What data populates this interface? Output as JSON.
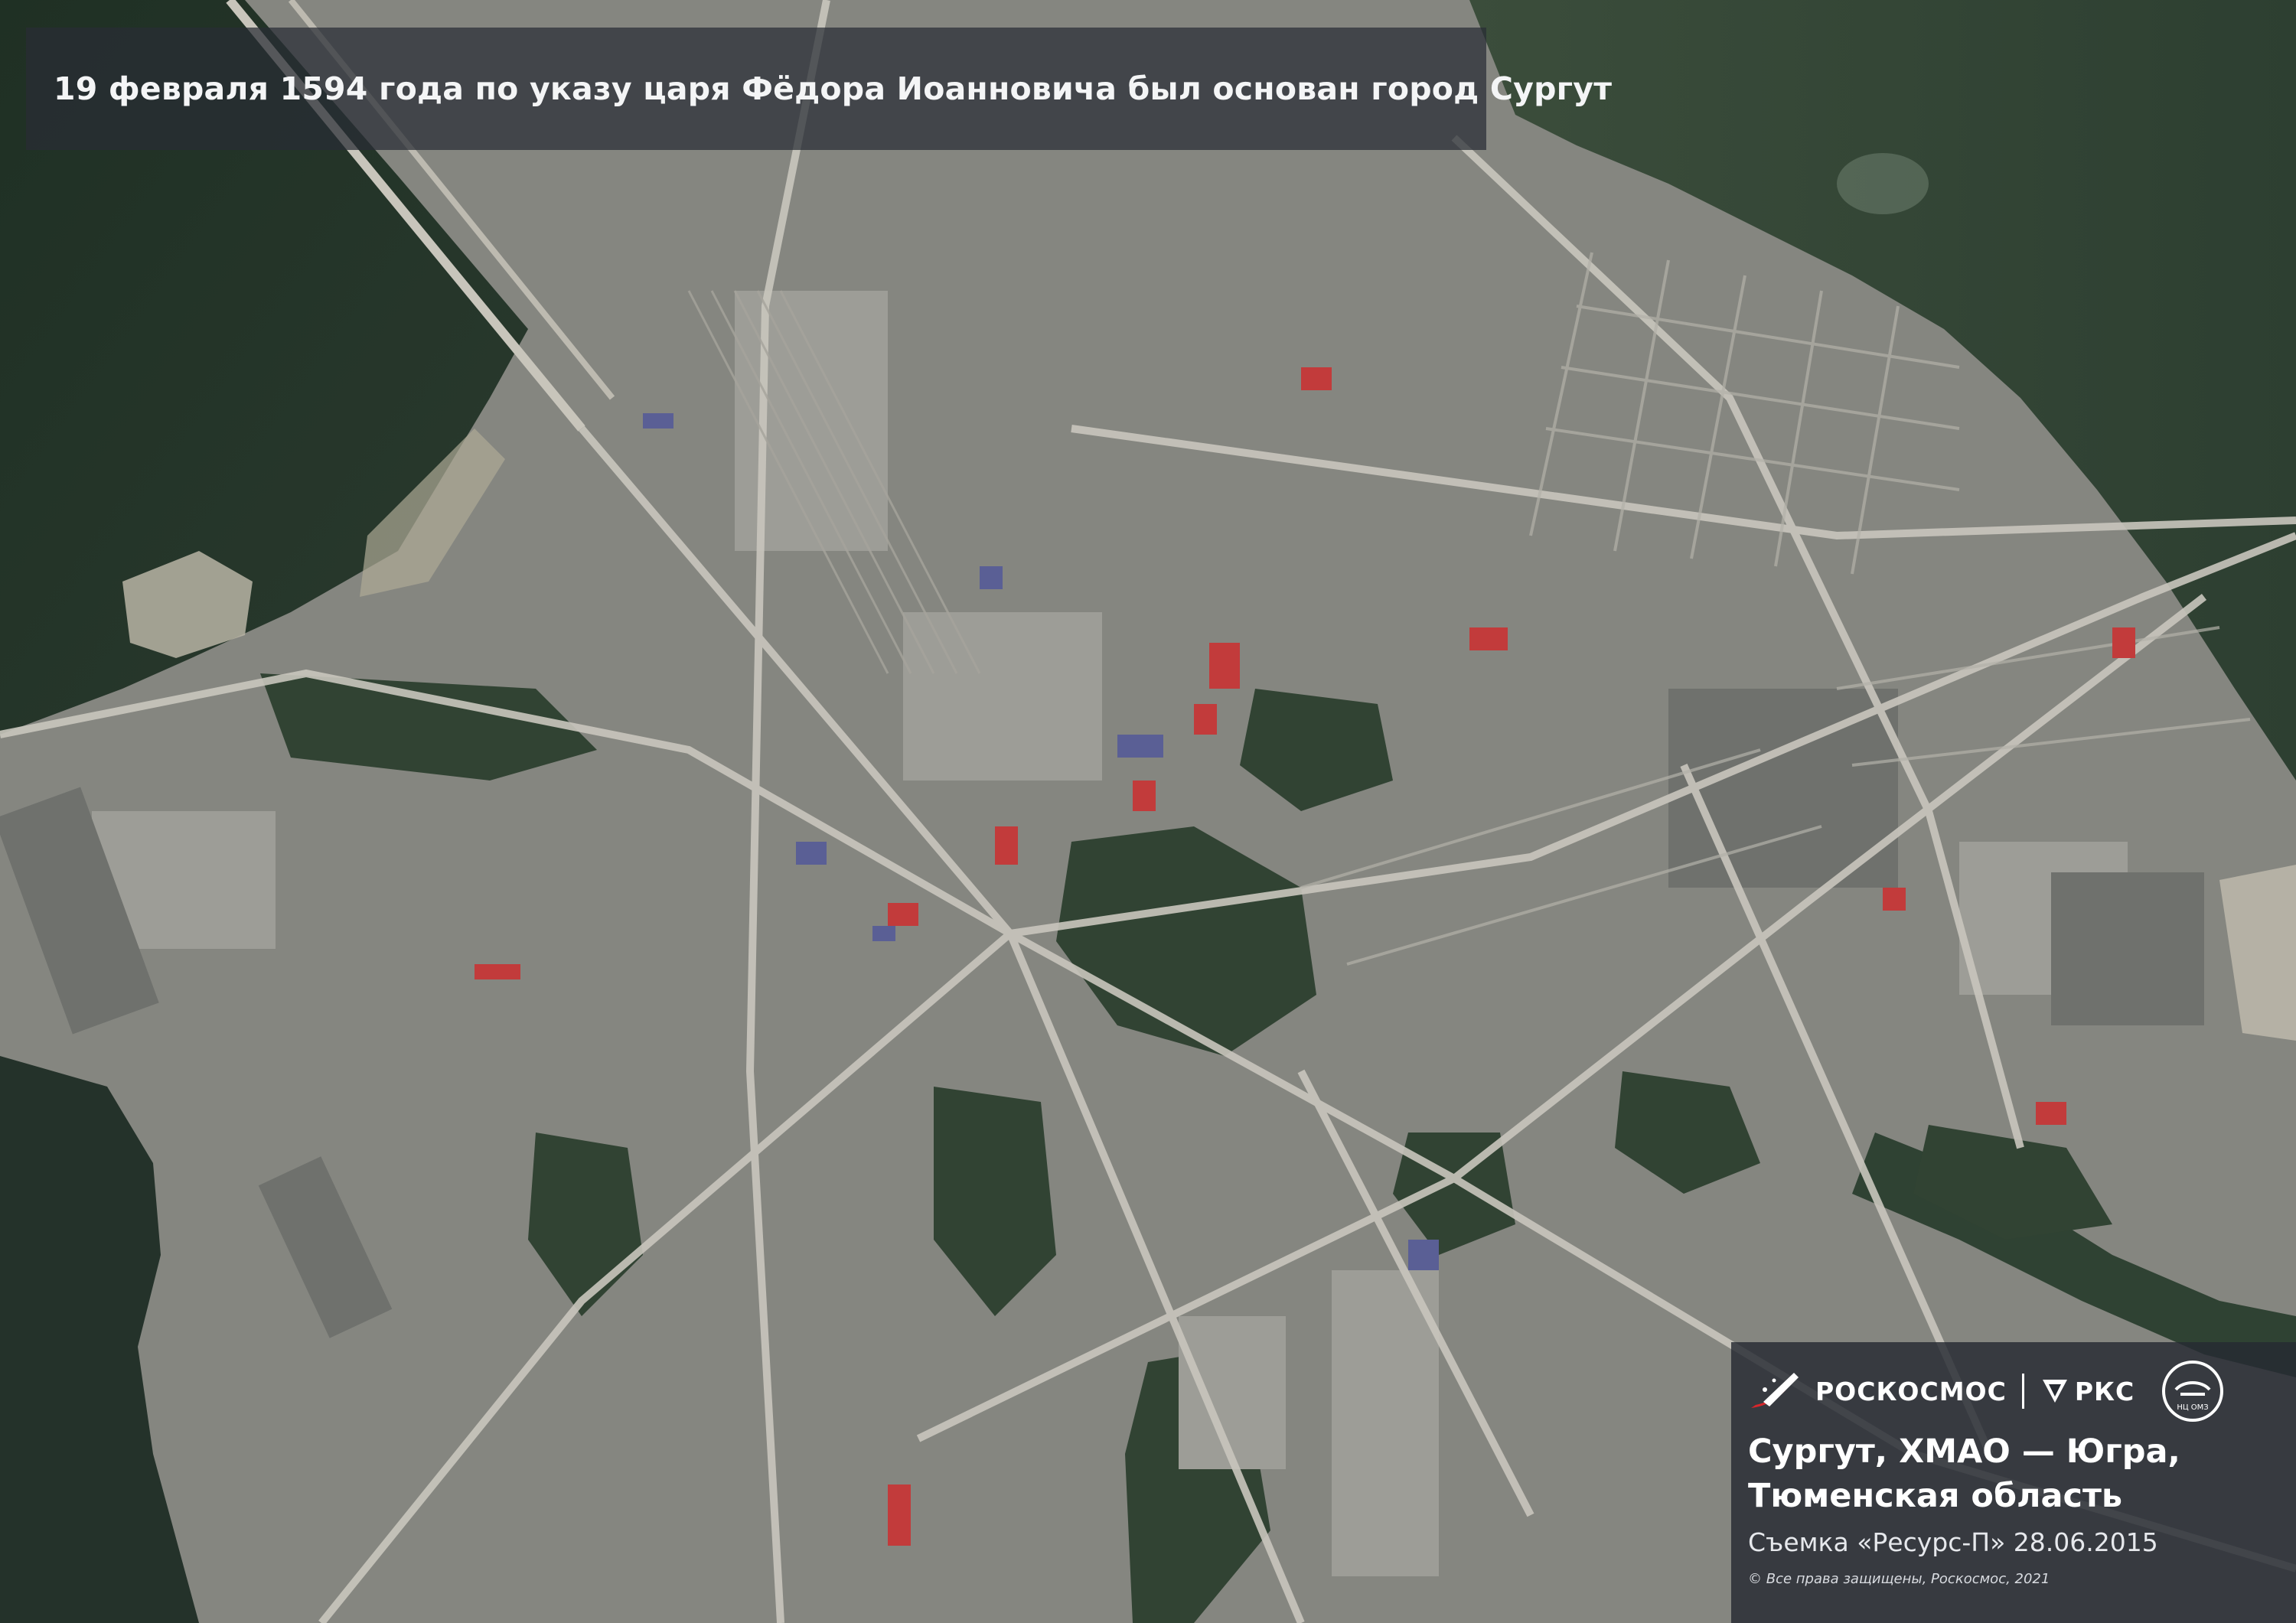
{
  "headline": {
    "text": "19 февраля 1594 года по указу царя Фёдора Иоанновича был основан город Сургут"
  },
  "caption": {
    "brand_roscosmos": "РОСКОСМОС",
    "brand_rks": "РКС",
    "center_logo_text": "НЦ ОМЗ",
    "place_line1": "Сургут, ХМАО — Югра,",
    "place_line2": "Тюменская область",
    "shoot_info": "Съемка «Ресурс-П» 28.06.2015",
    "copyright": "© Все права защищены, Роскосмос, 2021"
  },
  "colors": {
    "urban": "#8a8b86",
    "water": "#26372c",
    "forest": "#2c3d2e",
    "roads": "#c4c2bc",
    "roofs_red": "#c23b3b",
    "roofs_blue": "#5a5f95"
  },
  "icons": [
    "roscosmos-logo-icon",
    "rks-logo-icon",
    "nc-omz-logo-icon"
  ]
}
